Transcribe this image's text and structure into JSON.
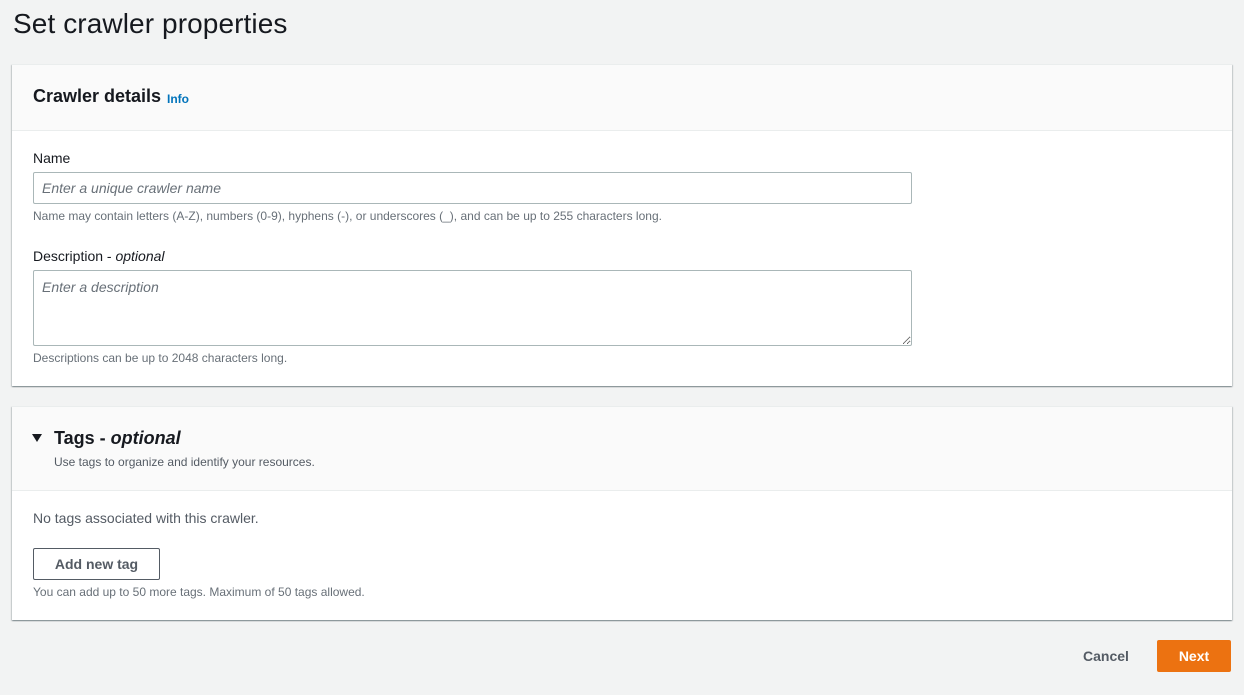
{
  "page": {
    "title": "Set crawler properties"
  },
  "details": {
    "title": "Crawler details",
    "info_label": "Info",
    "name_label": "Name",
    "name_value": "",
    "name_placeholder": "Enter a unique crawler name",
    "name_hint": "Name may contain letters (A-Z), numbers (0-9), hyphens (-), or underscores (_), and can be up to 255 characters long.",
    "description_label": "Description - ",
    "description_optional": "optional",
    "description_value": "",
    "description_placeholder": "Enter a description",
    "description_hint": "Descriptions can be up to 2048 characters long."
  },
  "tags": {
    "title": "Tags - ",
    "title_optional": "optional",
    "description": "Use tags to organize and identify your resources.",
    "empty_text": "No tags associated with this crawler.",
    "add_button": "Add new tag",
    "hint": "You can add up to 50 more tags. Maximum of 50 tags allowed."
  },
  "footer": {
    "cancel_label": "Cancel",
    "next_label": "Next"
  },
  "colors": {
    "primary": "#ec7211",
    "link": "#0073bb",
    "background": "#f2f3f3"
  }
}
